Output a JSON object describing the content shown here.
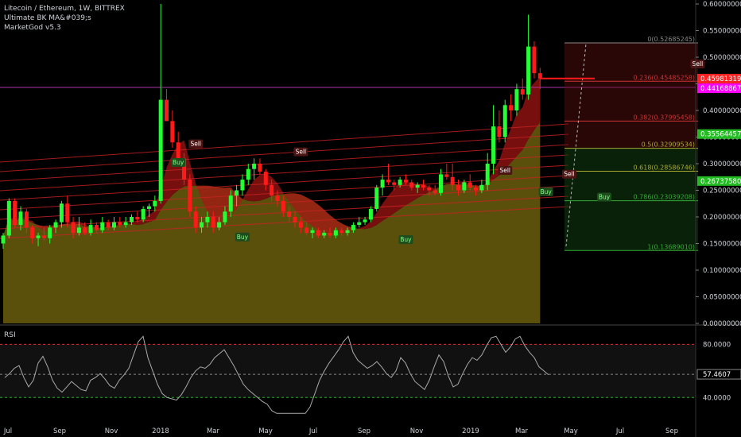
{
  "header": {
    "symbol": "Litecoin / Ethereum, 1W, BITTREX",
    "indicator_1": "Ultimate BK MA&#039;s",
    "indicator_2": "MarketGod v5.3"
  },
  "rsi_panel": {
    "label": "RSI"
  },
  "colors": {
    "background": "#000000",
    "up": "#22ff33",
    "down": "#ff1a1a",
    "text": "#d1d4dc",
    "price_tag_red": "#ff2222",
    "price_tag_magenta": "#ff00ff",
    "price_tag_green": "#22bb22",
    "rsi_line": "#aaaaaa",
    "rsi_upper": "#cc3333",
    "rsi_lower": "#33aa33"
  },
  "chart_data": {
    "type": "candlestick",
    "price_axis": {
      "ticks": [
        0.6,
        0.55,
        0.5,
        0.45,
        0.4,
        0.35,
        0.3,
        0.25,
        0.2,
        0.15,
        0.1,
        0.05,
        0.0
      ],
      "tick_labels": [
        "0.60000000",
        "0.55000000",
        "0.50000000",
        "0.45000000",
        "0.40000000",
        "0.35000000",
        "0.30000000",
        "0.25000000",
        "0.20000000",
        "0.15000000",
        "0.10000000",
        "0.05000000",
        "0.00000000"
      ],
      "range": [
        0,
        0.6
      ]
    },
    "time_axis": {
      "labels": [
        "Jul",
        "Sep",
        "Nov",
        "2018",
        "Mar",
        "May",
        "Jul",
        "Sep",
        "Nov",
        "2019",
        "Mar",
        "May",
        "Jul",
        "Sep"
      ],
      "start_index": 0
    },
    "price_tags": [
      {
        "value": 0.45981319,
        "label": "0.45981319",
        "color": "#ff2222"
      },
      {
        "value": 0.44168867,
        "label": "0.44168867",
        "color": "#ff00ff"
      },
      {
        "value": 0.35564457,
        "label": "0.35564457",
        "color": "#22bb22"
      },
      {
        "value": 0.2673758,
        "label": "0.26737580",
        "color": "#22bb22"
      }
    ],
    "fib_levels": [
      {
        "label": "0(0.52685245)",
        "value": 0.52685245
      },
      {
        "label": "0.236(0.45485258)",
        "value": 0.4548
      },
      {
        "label": "0.382(0.37995458)",
        "value": 0.38
      },
      {
        "label": "0.5(0.32909534)",
        "value": 0.329
      },
      {
        "label": "0.618(0.28586746)",
        "value": 0.2859
      },
      {
        "label": "0.786(0.23039208)",
        "value": 0.2304
      },
      {
        "label": "1(0.13689010)",
        "value": 0.1369
      }
    ],
    "signals": [
      {
        "text": "Buy",
        "candle": 30,
        "value": 0.3
      },
      {
        "text": "Sell",
        "candle": 33,
        "value": 0.335
      },
      {
        "text": "Buy",
        "candle": 41,
        "value": 0.16
      },
      {
        "text": "Sell",
        "candle": 51,
        "value": 0.32
      },
      {
        "text": "Buy",
        "candle": 69,
        "value": 0.155
      },
      {
        "text": "Sell",
        "candle": 86,
        "value": 0.285
      },
      {
        "text": "Buy",
        "candle": 93,
        "value": 0.245
      },
      {
        "text": "Sell",
        "candle": 97,
        "value": 0.278
      },
      {
        "text": "Buy",
        "candle": 103,
        "value": 0.235
      },
      {
        "text": "Sell",
        "candle": 119,
        "value": 0.485
      }
    ],
    "rsi": {
      "levels": [
        80,
        40
      ],
      "tick_labels": [
        "80.0000",
        "40.0000"
      ],
      "current": 57.4607,
      "current_label": "57.4607",
      "values": [
        55,
        58,
        62,
        64,
        55,
        48,
        53,
        66,
        71,
        63,
        53,
        47,
        44,
        48,
        52,
        49,
        46,
        45,
        53,
        55,
        58,
        54,
        49,
        47,
        53,
        57,
        62,
        72,
        82,
        86,
        70,
        60,
        50,
        43,
        40,
        39,
        38,
        42,
        48,
        55,
        60,
        63,
        62,
        65,
        70,
        73,
        76,
        70,
        64,
        57,
        50,
        46,
        43,
        40,
        37,
        35,
        30,
        25,
        21,
        18,
        15,
        14,
        17,
        24,
        33,
        43,
        53,
        60,
        66,
        71,
        76,
        82,
        86,
        74,
        68,
        65,
        62,
        64,
        67,
        63,
        58,
        55,
        60,
        70,
        66,
        58,
        52,
        49,
        46,
        53,
        63,
        72,
        67,
        56,
        48,
        50,
        58,
        65,
        70,
        68,
        72,
        79,
        85,
        86,
        80,
        74,
        78,
        84,
        86,
        79,
        74,
        70,
        63,
        60,
        57
      ]
    },
    "candles": [
      [
        0.15,
        0.17,
        0.14,
        0.165
      ],
      [
        0.165,
        0.235,
        0.16,
        0.23
      ],
      [
        0.23,
        0.235,
        0.18,
        0.185
      ],
      [
        0.185,
        0.22,
        0.175,
        0.21
      ],
      [
        0.21,
        0.215,
        0.17,
        0.18
      ],
      [
        0.18,
        0.185,
        0.15,
        0.16
      ],
      [
        0.16,
        0.17,
        0.145,
        0.165
      ],
      [
        0.165,
        0.18,
        0.155,
        0.16
      ],
      [
        0.16,
        0.185,
        0.15,
        0.18
      ],
      [
        0.18,
        0.195,
        0.17,
        0.19
      ],
      [
        0.19,
        0.23,
        0.18,
        0.225
      ],
      [
        0.225,
        0.24,
        0.18,
        0.19
      ],
      [
        0.19,
        0.2,
        0.16,
        0.17
      ],
      [
        0.17,
        0.2,
        0.165,
        0.18
      ],
      [
        0.18,
        0.19,
        0.165,
        0.17
      ],
      [
        0.17,
        0.195,
        0.165,
        0.185
      ],
      [
        0.185,
        0.19,
        0.17,
        0.175
      ],
      [
        0.175,
        0.2,
        0.17,
        0.19
      ],
      [
        0.19,
        0.195,
        0.175,
        0.18
      ],
      [
        0.18,
        0.2,
        0.175,
        0.19
      ],
      [
        0.19,
        0.2,
        0.18,
        0.185
      ],
      [
        0.185,
        0.2,
        0.18,
        0.19
      ],
      [
        0.19,
        0.205,
        0.185,
        0.2
      ],
      [
        0.2,
        0.21,
        0.19,
        0.195
      ],
      [
        0.195,
        0.22,
        0.19,
        0.215
      ],
      [
        0.215,
        0.225,
        0.2,
        0.22
      ],
      [
        0.22,
        0.24,
        0.21,
        0.23
      ],
      [
        0.23,
        0.6,
        0.225,
        0.42
      ],
      [
        0.42,
        0.44,
        0.38,
        0.38
      ],
      [
        0.38,
        0.4,
        0.33,
        0.34
      ],
      [
        0.34,
        0.36,
        0.3,
        0.31
      ],
      [
        0.31,
        0.32,
        0.26,
        0.27
      ],
      [
        0.27,
        0.28,
        0.2,
        0.21
      ],
      [
        0.21,
        0.22,
        0.17,
        0.18
      ],
      [
        0.18,
        0.2,
        0.17,
        0.19
      ],
      [
        0.19,
        0.21,
        0.18,
        0.2
      ],
      [
        0.2,
        0.21,
        0.17,
        0.18
      ],
      [
        0.18,
        0.2,
        0.175,
        0.19
      ],
      [
        0.19,
        0.22,
        0.185,
        0.21
      ],
      [
        0.21,
        0.25,
        0.2,
        0.24
      ],
      [
        0.24,
        0.26,
        0.22,
        0.25
      ],
      [
        0.25,
        0.28,
        0.24,
        0.27
      ],
      [
        0.27,
        0.3,
        0.26,
        0.29
      ],
      [
        0.29,
        0.31,
        0.27,
        0.3
      ],
      [
        0.3,
        0.31,
        0.28,
        0.285
      ],
      [
        0.285,
        0.29,
        0.25,
        0.26
      ],
      [
        0.26,
        0.27,
        0.23,
        0.24
      ],
      [
        0.24,
        0.25,
        0.22,
        0.23
      ],
      [
        0.23,
        0.24,
        0.2,
        0.21
      ],
      [
        0.21,
        0.22,
        0.19,
        0.2
      ],
      [
        0.2,
        0.21,
        0.18,
        0.19
      ],
      [
        0.19,
        0.2,
        0.17,
        0.18
      ],
      [
        0.18,
        0.19,
        0.165,
        0.17
      ],
      [
        0.17,
        0.18,
        0.16,
        0.175
      ],
      [
        0.175,
        0.18,
        0.16,
        0.165
      ],
      [
        0.165,
        0.175,
        0.16,
        0.17
      ],
      [
        0.17,
        0.18,
        0.16,
        0.165
      ],
      [
        0.165,
        0.18,
        0.16,
        0.175
      ],
      [
        0.175,
        0.18,
        0.165,
        0.17
      ],
      [
        0.17,
        0.18,
        0.165,
        0.175
      ],
      [
        0.175,
        0.19,
        0.17,
        0.185
      ],
      [
        0.185,
        0.2,
        0.18,
        0.19
      ],
      [
        0.19,
        0.2,
        0.185,
        0.195
      ],
      [
        0.195,
        0.22,
        0.19,
        0.215
      ],
      [
        0.215,
        0.26,
        0.21,
        0.255
      ],
      [
        0.255,
        0.28,
        0.24,
        0.27
      ],
      [
        0.27,
        0.3,
        0.26,
        0.265
      ],
      [
        0.265,
        0.27,
        0.25,
        0.26
      ],
      [
        0.26,
        0.275,
        0.255,
        0.27
      ],
      [
        0.27,
        0.28,
        0.26,
        0.265
      ],
      [
        0.265,
        0.27,
        0.25,
        0.255
      ],
      [
        0.255,
        0.265,
        0.245,
        0.26
      ],
      [
        0.26,
        0.27,
        0.25,
        0.255
      ],
      [
        0.255,
        0.26,
        0.24,
        0.25
      ],
      [
        0.25,
        0.26,
        0.24,
        0.245
      ],
      [
        0.245,
        0.29,
        0.24,
        0.28
      ],
      [
        0.28,
        0.3,
        0.27,
        0.275
      ],
      [
        0.275,
        0.3,
        0.25,
        0.26
      ],
      [
        0.26,
        0.27,
        0.24,
        0.25
      ],
      [
        0.25,
        0.27,
        0.245,
        0.265
      ],
      [
        0.265,
        0.28,
        0.25,
        0.255
      ],
      [
        0.255,
        0.26,
        0.24,
        0.25
      ],
      [
        0.25,
        0.27,
        0.245,
        0.26
      ],
      [
        0.26,
        0.32,
        0.25,
        0.3
      ],
      [
        0.3,
        0.41,
        0.28,
        0.37
      ],
      [
        0.37,
        0.4,
        0.34,
        0.35
      ],
      [
        0.35,
        0.42,
        0.34,
        0.41
      ],
      [
        0.41,
        0.43,
        0.38,
        0.4
      ],
      [
        0.4,
        0.45,
        0.39,
        0.44
      ],
      [
        0.44,
        0.46,
        0.42,
        0.43
      ],
      [
        0.43,
        0.58,
        0.42,
        0.52
      ],
      [
        0.52,
        0.53,
        0.46,
        0.47
      ],
      [
        0.47,
        0.48,
        0.44,
        0.46
      ]
    ]
  }
}
